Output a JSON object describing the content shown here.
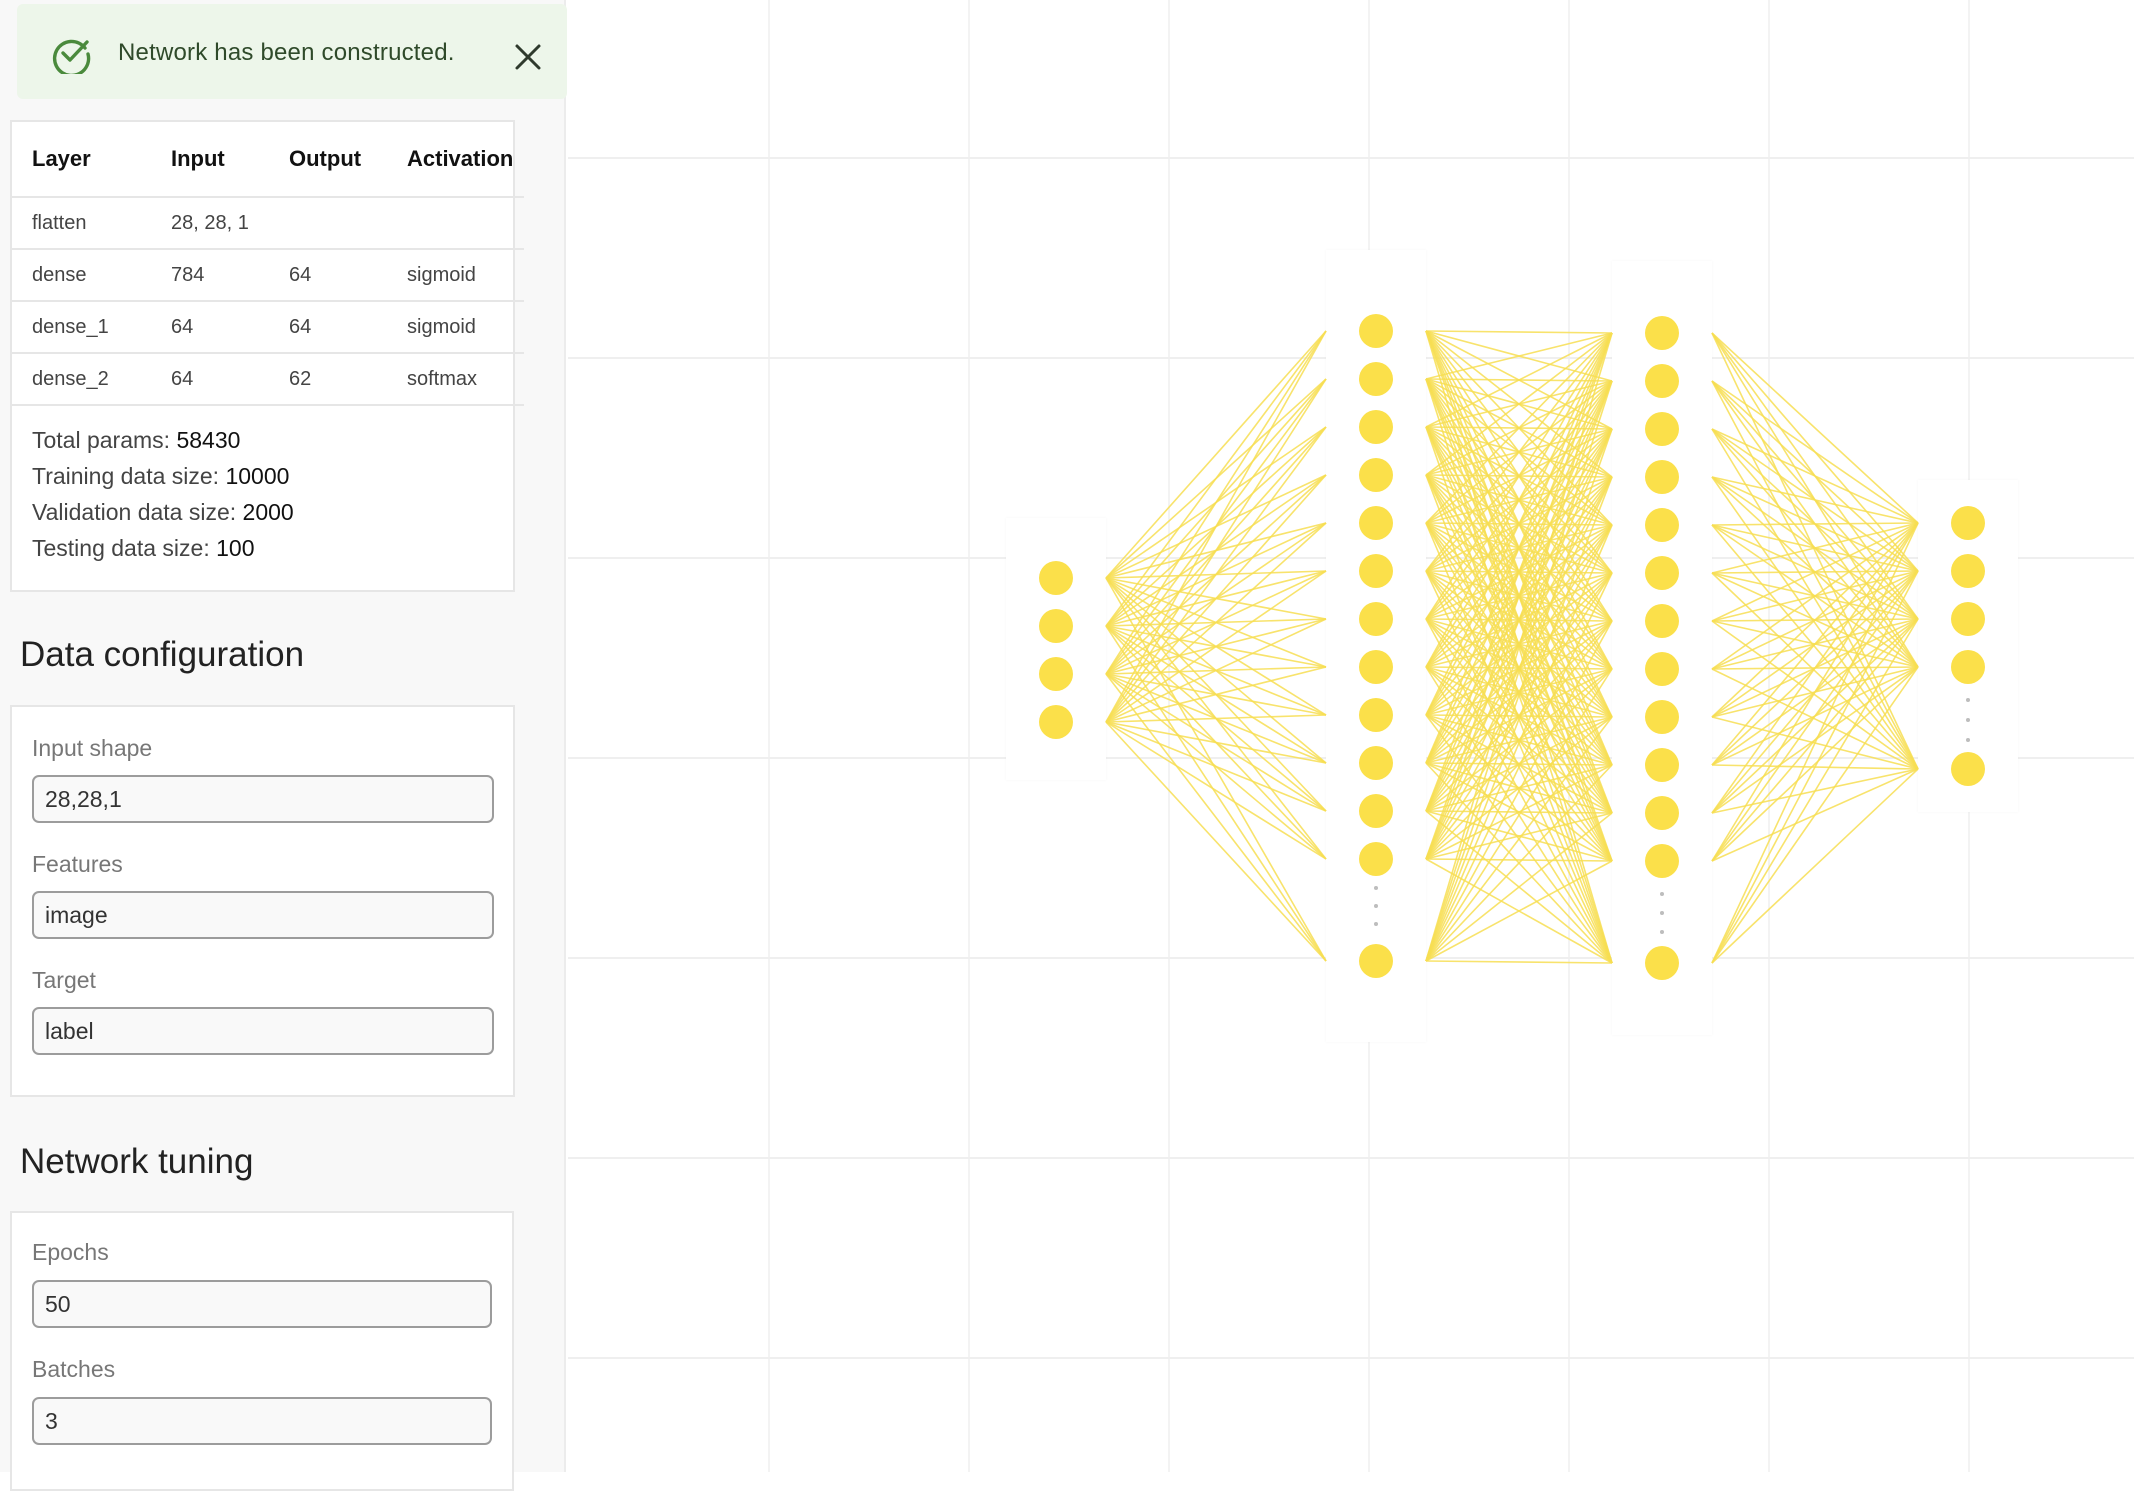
{
  "toast": {
    "message": "Network has been constructed.",
    "icon": "check-circle-icon",
    "close_icon": "close-icon",
    "color": "#4a8a3c"
  },
  "summary": {
    "columns": [
      "Layer",
      "Input",
      "Output",
      "Activation"
    ],
    "rows": [
      {
        "layer": "flatten",
        "input": "28, 28, 1",
        "output": "",
        "activation": ""
      },
      {
        "layer": "dense",
        "input": "784",
        "output": "64",
        "activation": "sigmoid"
      },
      {
        "layer": "dense_1",
        "input": "64",
        "output": "64",
        "activation": "sigmoid"
      },
      {
        "layer": "dense_2",
        "input": "64",
        "output": "62",
        "activation": "softmax"
      }
    ],
    "stats": [
      {
        "label": "Total params:",
        "value": "58430"
      },
      {
        "label": "Training data size:",
        "value": "10000"
      },
      {
        "label": "Validation data size:",
        "value": "2000"
      },
      {
        "label": "Testing data size:",
        "value": "100"
      }
    ]
  },
  "data_configuration": {
    "title": "Data configuration",
    "fields": [
      {
        "label": "Input shape",
        "value": "28,28,1"
      },
      {
        "label": "Features",
        "value": "image"
      },
      {
        "label": "Target",
        "value": "label"
      }
    ]
  },
  "network_tuning": {
    "title": "Network tuning",
    "fields": [
      {
        "label": "Epochs",
        "value": "50"
      },
      {
        "label": "Batches",
        "value": "3"
      }
    ]
  },
  "network_graph": {
    "node_color": "#fbe04a",
    "edge_color": "#f7de52",
    "layers": [
      {
        "visible_nodes": 4,
        "truncated": false,
        "last_node_shown": false
      },
      {
        "visible_nodes": 12,
        "truncated": true,
        "last_node_shown": true
      },
      {
        "visible_nodes": 12,
        "truncated": true,
        "last_node_shown": true
      },
      {
        "visible_nodes": 4,
        "truncated": true,
        "last_node_shown": true
      }
    ]
  }
}
